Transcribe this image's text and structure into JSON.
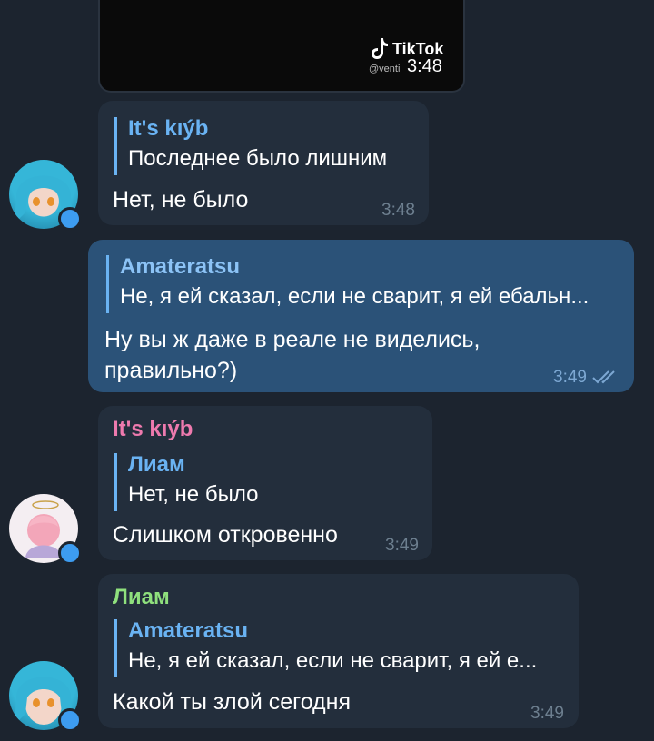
{
  "video": {
    "brand": "TikTok",
    "handle": "@venti",
    "time": "3:48"
  },
  "messages": [
    {
      "reply_name": "It's kıýb",
      "reply_text": "Последнее было лишним",
      "text": "Нет, не было",
      "time": "3:48"
    },
    {
      "reply_name": "Amateratsu",
      "reply_text": "Не, я ей сказал, если не сварит, я ей ебальн...",
      "text_line1": "Ну вы ж даже в реале не виделись,",
      "text_line2": "правильно?)",
      "time": "3:49"
    },
    {
      "sender": "It's kıýb",
      "reply_name": "Лиам",
      "reply_text": "Нет, не было",
      "text": "Слишком откровенно",
      "time": "3:49"
    },
    {
      "sender": "Лиам",
      "reply_name": "Amateratsu",
      "reply_text": "Не, я ей сказал, если не сварит, я ей е...",
      "text": "Какой ты злой сегодня",
      "time": "3:49"
    }
  ],
  "colors": {
    "background": "#1c242f",
    "incoming_bubble": "#232e3c",
    "outgoing_bubble": "#2b5278",
    "reply_accent": "#6ab3f3",
    "sender_pink": "#ee7aae",
    "sender_green": "#8fe07d",
    "read_checks": "#7da8d3"
  },
  "icons": {
    "read_status": "double-check-icon",
    "tiktok_logo": "tiktok-logo-icon"
  }
}
